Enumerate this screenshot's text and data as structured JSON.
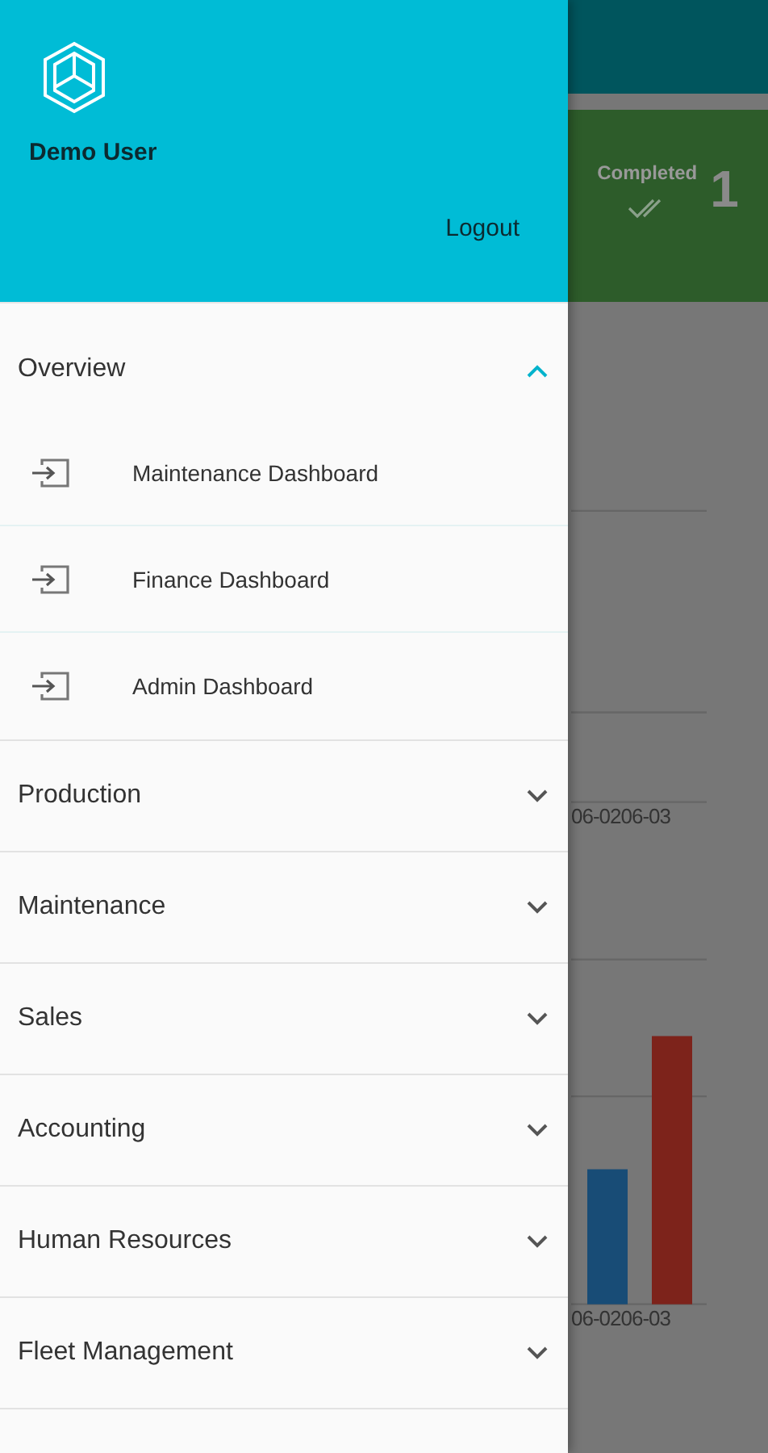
{
  "drawer": {
    "user_name": "Demo User",
    "logout": "Logout",
    "sections": [
      {
        "label": "Overview",
        "expanded": true,
        "children": [
          {
            "label": "Maintenance Dashboard"
          },
          {
            "label": "Finance Dashboard"
          },
          {
            "label": "Admin Dashboard"
          }
        ]
      },
      {
        "label": "Production",
        "expanded": false
      },
      {
        "label": "Maintenance",
        "expanded": false
      },
      {
        "label": "Sales",
        "expanded": false
      },
      {
        "label": "Accounting",
        "expanded": false
      },
      {
        "label": "Human Resources",
        "expanded": false
      },
      {
        "label": "Fleet Management",
        "expanded": false
      }
    ]
  },
  "background": {
    "completed_card": {
      "label": "Completed",
      "count": "1"
    },
    "charts": [
      {
        "kind": "empty",
        "x_labels": [
          "06-02",
          "06-03"
        ]
      },
      {
        "kind": "bars",
        "x_labels": [
          "06-02",
          "06-03"
        ]
      }
    ]
  }
}
